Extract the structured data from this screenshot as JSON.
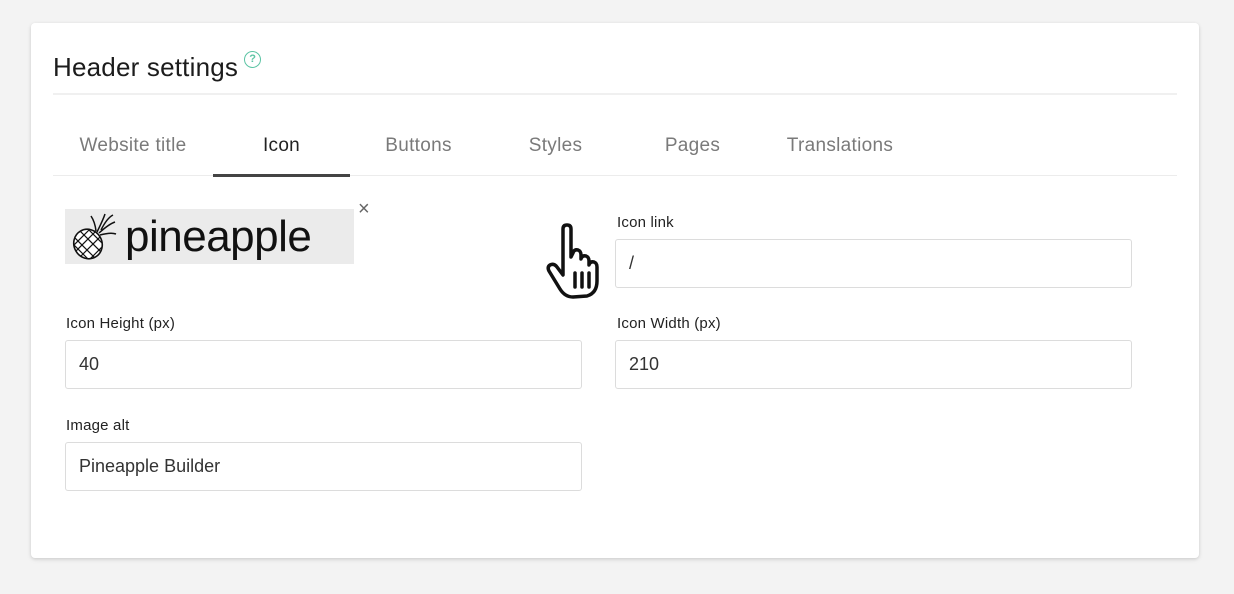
{
  "header": {
    "title": "Header settings",
    "help_icon": "question-circle-icon",
    "help_glyph": "?"
  },
  "tabs": [
    {
      "label": "Website title",
      "active": false
    },
    {
      "label": "Icon",
      "active": true
    },
    {
      "label": "Buttons",
      "active": false
    },
    {
      "label": "Styles",
      "active": false
    },
    {
      "label": "Pages",
      "active": false
    },
    {
      "label": "Translations",
      "active": false
    }
  ],
  "icon_panel": {
    "logo_text": "pineapple",
    "logo_icon": "pineapple-icon",
    "remove_glyph": "×",
    "icon_link": {
      "label": "Icon link",
      "value": "/"
    },
    "icon_height": {
      "label": "Icon Height (px)",
      "value": "40"
    },
    "icon_width": {
      "label": "Icon Width (px)",
      "value": "210"
    },
    "image_alt": {
      "label": "Image alt",
      "value": "Pineapple Builder"
    }
  },
  "colors": {
    "accent": "#5cc4a4",
    "tab_active": "#222222",
    "tab_inactive": "#7a7a7a"
  }
}
